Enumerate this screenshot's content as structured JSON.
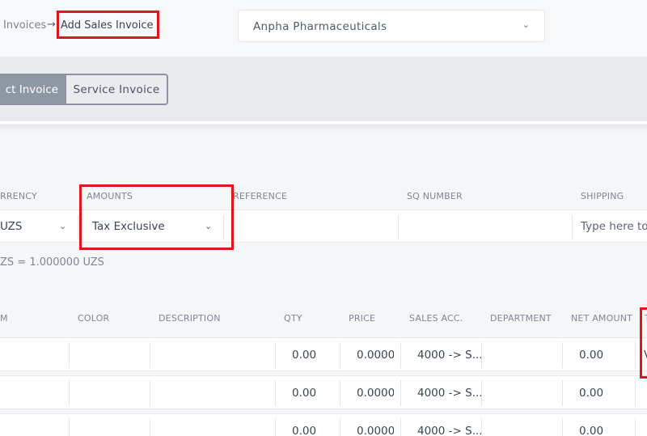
{
  "breadcrumb": {
    "parent": "Invoices",
    "arrow": "→",
    "current": "Add Sales Invoice"
  },
  "company_select": {
    "value": "Anpha Pharmaceuticals",
    "caret": "⌄"
  },
  "invoice_type": {
    "options": [
      "ct Invoice",
      "Service Invoice"
    ],
    "active_index": 0
  },
  "form": {
    "currency": {
      "label": "RRENCY",
      "value": "UZS",
      "caret": "⌄"
    },
    "amounts": {
      "label": "AMOUNTS",
      "value": "Tax Exclusive",
      "caret": "⌄"
    },
    "reference": {
      "label": "REFERENCE",
      "value": ""
    },
    "sq_number": {
      "label": "SQ NUMBER",
      "value": ""
    },
    "shipping": {
      "label": "SHIPPING",
      "placeholder": "Type here to"
    },
    "exchange_rate": "ZS = 1.000000 UZS"
  },
  "table": {
    "headers": {
      "item": "M",
      "color": "COLOR",
      "description": "DESCRIPTION",
      "qty": "QTY",
      "price": "PRICE",
      "sales_acc": "SALES ACC.",
      "department": "DEPARTMENT",
      "net_amount": "NET AMOUNT",
      "tax": "T"
    },
    "rows": [
      {
        "qty": "0.00",
        "price": "0.0000",
        "sales_acc": "4000 -> S...",
        "net_amount": "0.00",
        "tax": "V"
      },
      {
        "qty": "0.00",
        "price": "0.0000",
        "sales_acc": "4000 -> S...",
        "net_amount": "0.00",
        "tax": ""
      },
      {
        "qty": "0.00",
        "price": "0.0000",
        "sales_acc": "4000 -> S...",
        "net_amount": "0.00",
        "tax": ""
      }
    ]
  },
  "colors": {
    "highlight": "#e3141b",
    "toggle_active": "#8e97a4",
    "band": "#e9ebef"
  }
}
